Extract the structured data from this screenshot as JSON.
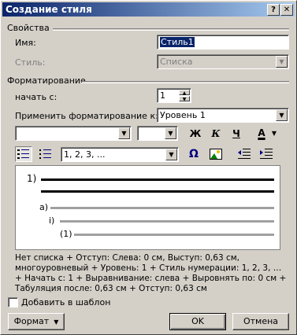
{
  "window": {
    "title": "Создание стиля",
    "help_label": "?",
    "close_label": "✕"
  },
  "properties": {
    "group_label": "Свойства",
    "name_label": "Имя:",
    "name_value": "Стиль1",
    "style_label": "Стиль:",
    "style_value": "Списка"
  },
  "formatting": {
    "group_label": "Форматирование",
    "start_label": "начать с:",
    "start_value": "1",
    "apply_label": "Применить форматирование к:",
    "apply_value": "Уровень 1",
    "font_value": "",
    "size_value": "",
    "bold_label": "Ж",
    "italic_label": "К",
    "underline_label": "Ч",
    "font_color_label": "A",
    "numbering_value": "1, 2, 3, ...",
    "symbol_label": "Ω"
  },
  "preview": {
    "labels": [
      "1)",
      "a)",
      "i)",
      "(1)"
    ]
  },
  "description": "Нет списка + Отступ: Слева:  0 см, Выступ:  0,63 см, многоуровневый + Уровень: 1 + Стиль нумерации: 1, 2, 3, … + Начать с: 1 + Выравнивание: слева + Выровнять по:  0 см + Табуляция после:  0,63 см + Отступ:  0,63 см",
  "add_template_label": "Добавить в шаблон",
  "buttons": {
    "format": "Формат",
    "ok": "OK",
    "cancel": "Отмена"
  }
}
